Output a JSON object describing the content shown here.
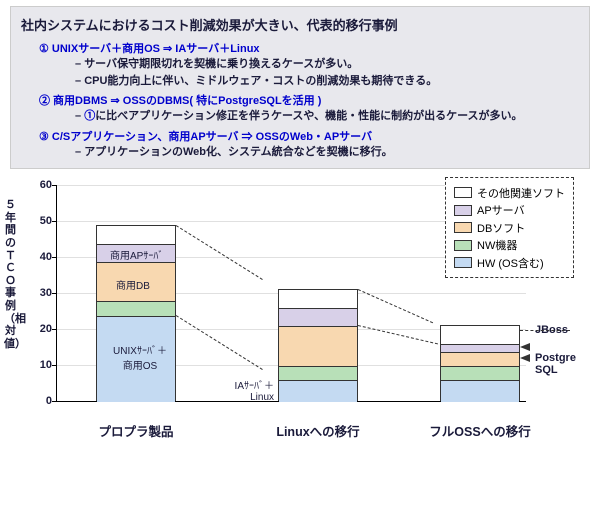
{
  "info": {
    "title": "社内システムにおけるコスト削減効果が大きい、代表的移行事例",
    "case1": "① UNIXサーバ＋商用OS ⇒ IAサーバ＋Linux",
    "case1_b1": "サーバ保守期限切れを契機に乗り換えるケースが多い。",
    "case1_b2": "CPU能力向上に伴い、ミドルウェア・コストの削減効果も期待できる。",
    "case2": "② 商用DBMS ⇒ OSSのDBMS( 特にPostgreSQLを活用 )",
    "case2_b1_a": "①",
    "case2_b1_b": "に比べアプリケーション修正を伴うケースや、機能・性能に制約が出るケースが多い。",
    "case3": "③ C/Sアプリケーション、商用APサーバ ⇒ OSSのWeb・APサーバ",
    "case3_b1": "アプリケーションのWeb化、システム統合などを契機に移行。"
  },
  "ylabel": "５年間のＴＣＯ事例（相対値）",
  "yticks": [
    "0",
    "10",
    "20",
    "30",
    "40",
    "50",
    "60"
  ],
  "legend": {
    "ot": "その他関連ソフト",
    "ap": "APサーバ",
    "db": "DBソフト",
    "nw": "NW機器",
    "hw": "HW (OS含む)"
  },
  "categories": [
    "プロプラ製品",
    "Linuxへの移行",
    "フルOSSへの移行"
  ],
  "ann": {
    "b1_hw": "UNIXｻｰﾊﾞ＋商用OS",
    "b1_db": "商用DB",
    "b1_ap": "商用APｻｰﾊﾞ",
    "b2_hw": "IAｻｰﾊﾞ＋Linux",
    "b3_ap": "JBoss",
    "b3_db": "Postgre SQL"
  },
  "chart_data": {
    "type": "bar",
    "stacked": true,
    "title": "",
    "xlabel": "",
    "ylabel": "５年間のＴＣＯ事例（相対値）",
    "ylim": [
      0,
      60
    ],
    "categories": [
      "プロプラ製品",
      "Linuxへの移行",
      "フルOSSへの移行"
    ],
    "series": [
      {
        "name": "HW (OS含む)",
        "values": [
          24,
          6,
          6
        ]
      },
      {
        "name": "NW機器",
        "values": [
          4,
          4,
          4
        ]
      },
      {
        "name": "DBソフト",
        "values": [
          11,
          11,
          4
        ]
      },
      {
        "name": "APサーバ",
        "values": [
          5,
          5,
          2
        ]
      },
      {
        "name": "その他関連ソフト",
        "values": [
          5,
          5,
          5
        ]
      }
    ],
    "totals": [
      49,
      31,
      21
    ]
  }
}
